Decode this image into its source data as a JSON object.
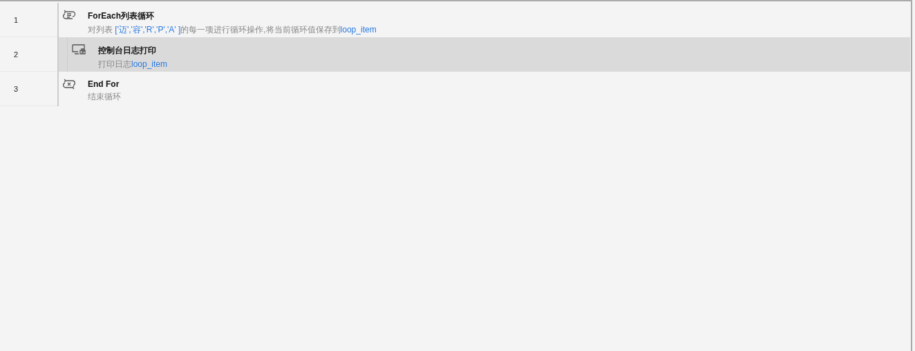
{
  "steps": [
    {
      "number": "1",
      "kind": "loop",
      "title": "ForEach列表循环",
      "selected": false,
      "description": [
        {
          "kind": "text",
          "text": "对列表 "
        },
        {
          "kind": "variable",
          "text": "['迈','容','R','P','A' ]"
        },
        {
          "kind": "text",
          "text": "的每一项进行循环操作,将当前循环值保存到"
        },
        {
          "kind": "variable",
          "text": "loop_item"
        }
      ],
      "children": [
        {
          "number": "2",
          "kind": "log",
          "title": "控制台日志打印",
          "selected": true,
          "description": [
            {
              "kind": "text",
              "text": "打印日志"
            },
            {
              "kind": "variable",
              "text": "loop_item"
            }
          ]
        }
      ]
    },
    {
      "number": "3",
      "kind": "endloop",
      "title": "End For",
      "selected": false,
      "description": [
        {
          "kind": "text",
          "text": "结束循环"
        }
      ]
    }
  ]
}
